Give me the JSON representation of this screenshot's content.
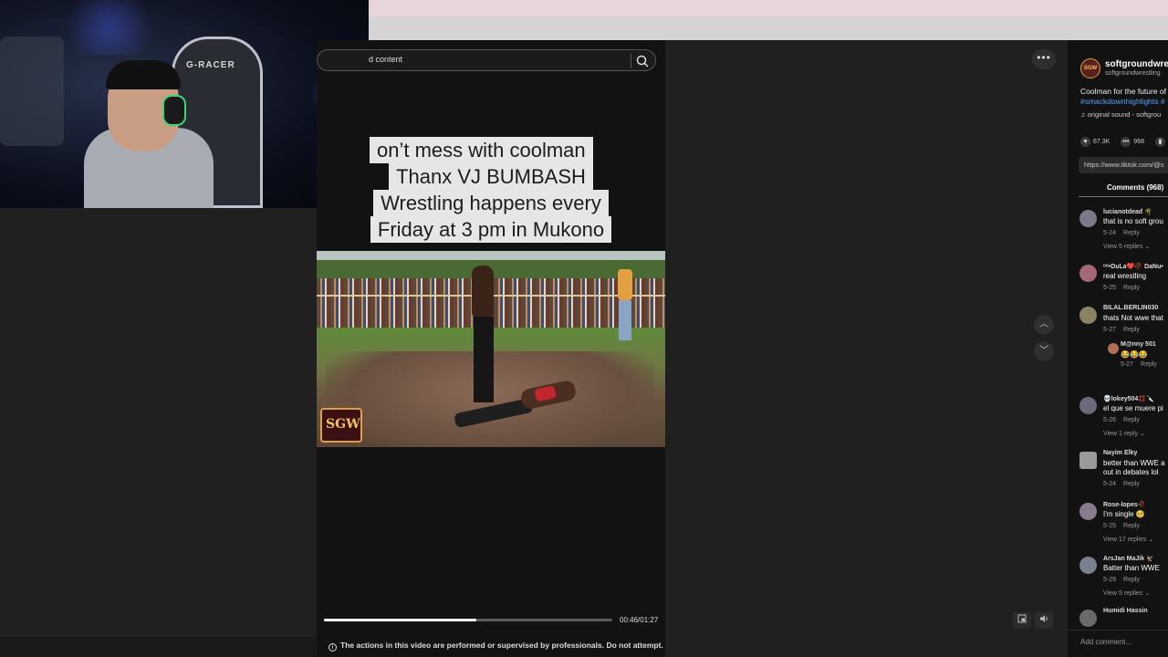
{
  "webcam": {
    "chair_brand": "G-RACER"
  },
  "search": {
    "placeholder": "d content"
  },
  "video": {
    "captions": [
      "on’t mess with coolman",
      "Thanx VJ BUMBASH",
      "Wrestling happens every",
      "Friday at 3 pm in Mukono"
    ],
    "watermark": "SGW",
    "progress_fraction": 0.53,
    "timecode": "00:46/01:27",
    "disclaimer": "The actions in this video are performed or supervised by professionals. Do not attempt.",
    "info_glyph": "i"
  },
  "controls": {
    "more": "•••",
    "prev": "︿",
    "next": "﹀"
  },
  "post": {
    "author_name": "softgroundwres",
    "author_handle": "softgroundwrestling",
    "description": "Coolman for the future of",
    "hashtags": "#smackdownhighlights #",
    "sound": "♫ original sound - softgrou",
    "likes": "67.3K",
    "comments_count": "968",
    "link": "https://www.tiktok.com/@s",
    "comments_tab": "Comments (968)"
  },
  "comments": [
    {
      "user": "lucianotdead 🌴",
      "text": "that is no soft grou",
      "date": "5-24",
      "reply": "Reply",
      "views": "View 5 replies ⌄"
    },
    {
      "user": "ᵒᵒ•DuLa❤️🥀 DaNu•",
      "text": "real wrestling",
      "date": "5-25",
      "reply": "Reply",
      "views": ""
    },
    {
      "user": "BILAL.BERLIN030",
      "text": "thats Not wwe that",
      "date": "5-27",
      "reply": "Reply",
      "views": "",
      "sub": {
        "user": "M@nny 501",
        "text": "😂😂😂",
        "date": "5-27",
        "reply": "Reply"
      }
    },
    {
      "user": "💀lokey504💢🔪",
      "text": "el que se muere pi",
      "date": "5-26",
      "reply": "Reply",
      "views": "View 1 reply ⌄"
    },
    {
      "user": "Nayim Elky",
      "text": "better than WWE a",
      "text2": "out in debates lol",
      "date": "5-24",
      "reply": "Reply",
      "views": ""
    },
    {
      "user": "Rose-lopes🥀",
      "text": "I'm single 🥺",
      "date": "5-25",
      "reply": "Reply",
      "views": "View 17 replies ⌄"
    },
    {
      "user": "ArsJan MaJik 🦅",
      "text": "Batter than WWE",
      "date": "5-29",
      "reply": "Reply",
      "views": "View 5 replies ⌄"
    },
    {
      "user": "Humidi Hassin",
      "text": "",
      "date": "",
      "reply": "",
      "views": ""
    }
  ],
  "add_comment": {
    "placeholder": "Add comment..."
  }
}
